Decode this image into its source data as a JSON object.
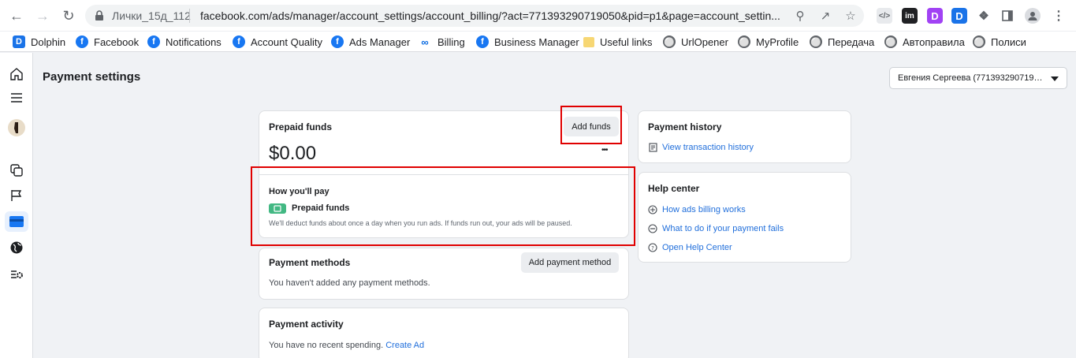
{
  "browser": {
    "tab_title": "Лички_15д_112",
    "url": "facebook.com/ads/manager/account_settings/account_billing/?act=771393290719050&pid=p1&page=account_settin...",
    "extensions": [
      "code-ext-icon",
      "im-ext-icon",
      "purple-d-ext-icon",
      "blue-d-ext-icon",
      "puzzle-icon",
      "sidepanel-icon",
      "profile-icon",
      "kebab-menu-icon"
    ]
  },
  "bookmarks": [
    {
      "label": "Dolphin",
      "icon": "dolphin-icon"
    },
    {
      "label": "Facebook",
      "icon": "facebook-icon"
    },
    {
      "label": "Notifications",
      "icon": "facebook-icon"
    },
    {
      "label": "Account Quality",
      "icon": "facebook-icon"
    },
    {
      "label": "Ads Manager",
      "icon": "facebook-icon"
    },
    {
      "label": "Billing",
      "icon": "meta-icon"
    },
    {
      "label": "Business Manager",
      "icon": "facebook-icon"
    },
    {
      "label": "Useful links",
      "icon": "folder-icon"
    },
    {
      "label": "UrlOpener",
      "icon": "globe-icon"
    },
    {
      "label": "MyProfile",
      "icon": "globe-icon"
    },
    {
      "label": "Передача",
      "icon": "globe-icon"
    },
    {
      "label": "Автоправила",
      "icon": "globe-icon"
    },
    {
      "label": "Полиси",
      "icon": "globe-icon"
    }
  ],
  "page": {
    "title": "Payment settings",
    "account_selector": "Евгения Сергеева (77139329071905..."
  },
  "prepaid": {
    "title": "Prepaid funds",
    "add_funds_label": "Add funds",
    "balance": "$0.00",
    "more_label": "•••",
    "how_title": "How you'll pay",
    "method_label": "Prepaid funds",
    "note": "We'll deduct funds about once a day when you run ads. If funds run out, your ads will be paused."
  },
  "payment_methods": {
    "title": "Payment methods",
    "add_label": "Add payment method",
    "empty_text": "You haven't added any payment methods."
  },
  "payment_activity": {
    "title": "Payment activity",
    "text": "You have no recent spending.",
    "link": "Create Ad"
  },
  "payment_history": {
    "title": "Payment history",
    "link": "View transaction history"
  },
  "help_center": {
    "title": "Help center",
    "links": [
      "How ads billing works",
      "What to do if your payment fails",
      "Open Help Center"
    ]
  },
  "colors": {
    "accent_link": "#216fdb",
    "highlight_red": "#e00000",
    "prepaid_badge": "#42b883"
  }
}
